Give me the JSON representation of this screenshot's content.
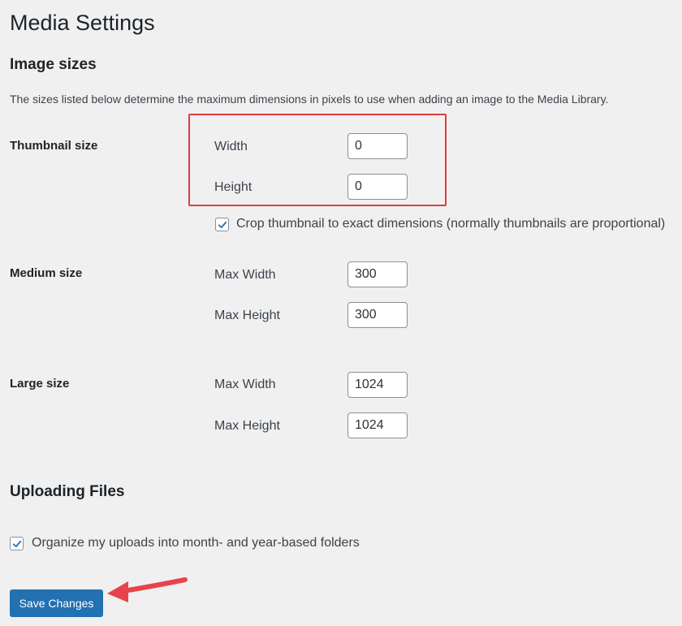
{
  "page_title": "Media Settings",
  "image_sizes": {
    "heading": "Image sizes",
    "description": "The sizes listed below determine the maximum dimensions in pixels to use when adding an image to the Media Library.",
    "thumbnail": {
      "label": "Thumbnail size",
      "width_label": "Width",
      "width_value": "0",
      "height_label": "Height",
      "height_value": "0",
      "crop_checked": true,
      "crop_label": "Crop thumbnail to exact dimensions (normally thumbnails are proportional)"
    },
    "medium": {
      "label": "Medium size",
      "width_label": "Max Width",
      "width_value": "300",
      "height_label": "Max Height",
      "height_value": "300"
    },
    "large": {
      "label": "Large size",
      "width_label": "Max Width",
      "width_value": "1024",
      "height_label": "Max Height",
      "height_value": "1024"
    }
  },
  "uploading": {
    "heading": "Uploading Files",
    "organize_checked": true,
    "organize_label": "Organize my uploads into month- and year-based folders"
  },
  "save_button_label": "Save Changes",
  "colors": {
    "highlight_box": "#e03c3c",
    "annotation_arrow": "#e8434a",
    "primary_button": "#2271b1",
    "checkmark": "#2271b1"
  }
}
